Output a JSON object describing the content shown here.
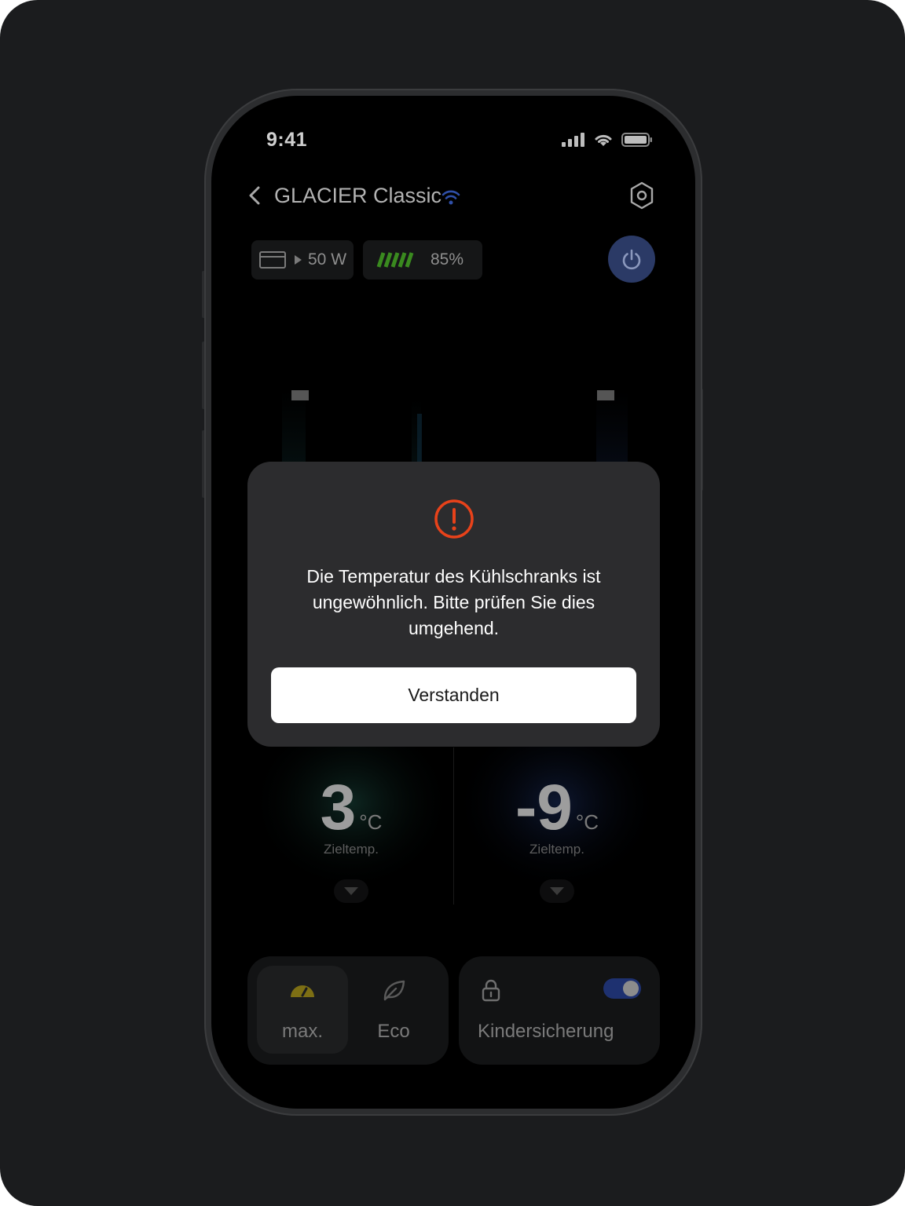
{
  "status_bar": {
    "time": "9:41"
  },
  "nav": {
    "title": "GLACIER Classic"
  },
  "chips": {
    "power_input": "50 W",
    "battery_percent": "85%"
  },
  "temperatures": {
    "left": {
      "value": "3",
      "unit": "°C",
      "label": "Zieltemp."
    },
    "right": {
      "value": "-9",
      "unit": "°C",
      "label": "Zieltemp."
    }
  },
  "modes": {
    "max_label": "max.",
    "eco_label": "Eco",
    "selected": "max."
  },
  "child_lock": {
    "label": "Kindersicherung",
    "enabled": true
  },
  "dialog": {
    "message": "Die Temperatur des Kühlschranks ist ungewöhnlich. Bitte prüfen Sie dies umgehend.",
    "button_label": "Verstanden"
  },
  "colors": {
    "alert": "#e8421a",
    "power_button": "#2b3a66",
    "battery_bar": "#3a8a1f",
    "max_icon": "#8a7a1a",
    "toggle": "#1e3170"
  }
}
